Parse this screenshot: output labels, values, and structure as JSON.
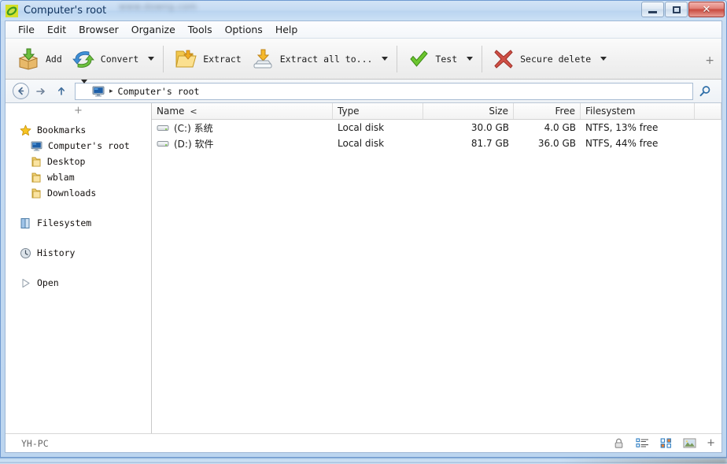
{
  "window": {
    "title": "Computer's root",
    "app_icon": "peazip-pea-icon",
    "watermark_text": "www.downg.com",
    "controls": [
      {
        "name": "minimize-button",
        "label": ""
      },
      {
        "name": "maximize-button",
        "label": ""
      },
      {
        "name": "close-button",
        "label": "✕"
      }
    ]
  },
  "menubar": {
    "items": [
      {
        "label": "File"
      },
      {
        "label": "Edit"
      },
      {
        "label": "Browser"
      },
      {
        "label": "Organize"
      },
      {
        "label": "Tools"
      },
      {
        "label": "Options"
      },
      {
        "label": "Help"
      }
    ]
  },
  "toolbar": {
    "buttons": [
      {
        "label": "Add",
        "icon": "add-box-icon",
        "dropdown": false
      },
      {
        "label": "Convert",
        "icon": "convert-arrows-icon",
        "dropdown": true
      },
      {
        "label": "Extract",
        "icon": "extract-folder-icon",
        "dropdown": false
      },
      {
        "label": "Extract all to...",
        "icon": "extract-all-drive-icon",
        "dropdown": true
      },
      {
        "label": "Test",
        "icon": "test-checkmark-icon",
        "dropdown": true
      },
      {
        "label": "Secure delete",
        "icon": "secure-delete-x-icon",
        "dropdown": true
      }
    ],
    "expand_label": "+"
  },
  "addressbar": {
    "back_icon": "back-arrow-icon",
    "forward_icon": "forward-arrow-icon",
    "up_icon": "up-arrow-icon",
    "dropdown_icon": "chevron-down-icon",
    "location_icon": "computer-monitor-icon",
    "separator": "▸",
    "path": "Computer's root",
    "search_icon": "search-icon"
  },
  "sidebar": {
    "add_label": "+",
    "groups": [
      {
        "header": {
          "label": "Bookmarks",
          "icon": "star-icon"
        },
        "items": [
          {
            "label": "Computer's root",
            "icon": "computer-monitor-icon"
          },
          {
            "label": "Desktop",
            "icon": "folder-icon"
          },
          {
            "label": "wblam",
            "icon": "folder-icon"
          },
          {
            "label": "Downloads",
            "icon": "folder-icon"
          }
        ]
      },
      {
        "header": {
          "label": "Filesystem",
          "icon": "filesystem-book-icon"
        },
        "items": []
      },
      {
        "header": {
          "label": "History",
          "icon": "clock-icon"
        },
        "items": []
      },
      {
        "header": {
          "label": "Open",
          "icon": "play-triangle-icon"
        },
        "items": []
      }
    ]
  },
  "filelist": {
    "columns": [
      {
        "key": "name",
        "label": "Name",
        "sort": "<"
      },
      {
        "key": "type",
        "label": "Type",
        "sort": ""
      },
      {
        "key": "size",
        "label": "Size",
        "sort": ""
      },
      {
        "key": "free",
        "label": "Free",
        "sort": ""
      },
      {
        "key": "filesystem",
        "label": "Filesystem",
        "sort": ""
      }
    ],
    "rows": [
      {
        "icon": "hard-drive-icon",
        "name": "(C:) 系统",
        "type": "Local disk",
        "size": "30.0 GB",
        "free": "4.0 GB",
        "filesystem": "NTFS, 13% free"
      },
      {
        "icon": "hard-drive-icon",
        "name": "(D:) 软件",
        "type": "Local disk",
        "size": "81.7 GB",
        "free": "36.0 GB",
        "filesystem": "NTFS, 44% free"
      }
    ]
  },
  "statusbar": {
    "text": "YH-PC",
    "icons": [
      {
        "name": "lock-icon"
      },
      {
        "name": "details-view-icon"
      },
      {
        "name": "icons-view-icon"
      },
      {
        "name": "preview-image-icon"
      }
    ],
    "plus_label": "+"
  },
  "colors": {
    "aero_border": "#6f9ad1",
    "close_red": "#c94b40",
    "accent_blue": "#2f6fa8",
    "folder_yellow": "#f5c84a",
    "green": "#6cbf3e"
  }
}
